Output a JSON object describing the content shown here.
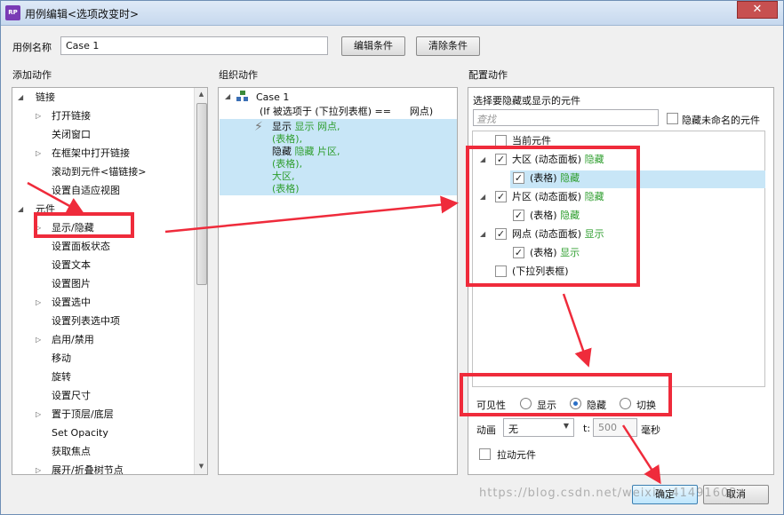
{
  "window": {
    "title": "用例编辑<选项改变时>",
    "app_icon": "RP",
    "close_symbol": "✕"
  },
  "case_name": {
    "label": "用例名称",
    "value": "Case 1"
  },
  "buttons": {
    "edit_condition": "编辑条件",
    "clear_condition": "清除条件",
    "ok": "确定",
    "cancel": "取消"
  },
  "add_action": {
    "header": "添加动作",
    "groups": [
      {
        "label": "链接",
        "items": [
          "打开链接",
          "关闭窗口",
          "在框架中打开链接",
          "滚动到元件<锚链接>",
          "设置自适应视图"
        ]
      },
      {
        "label": "元件",
        "items": [
          "显示/隐藏",
          "设置面板状态",
          "设置文本",
          "设置图片",
          "设置选中",
          "设置列表选中项",
          "启用/禁用",
          "移动",
          "旋转",
          "设置尺寸",
          "置于顶层/底层",
          "Set Opacity",
          "获取焦点",
          "展开/折叠树节点"
        ]
      }
    ]
  },
  "organize_action": {
    "header": "组织动作",
    "case_label": "Case 1",
    "condition": "(If 被选项于 (下拉列表框) ==      网点)",
    "action_lines": [
      "显示 网点,",
      "(表格),",
      "隐藏 片区,",
      "(表格),",
      "大区,",
      "(表格)"
    ]
  },
  "configure_action": {
    "header": "配置动作",
    "subheader": "选择要隐藏或显示的元件",
    "search_placeholder": "查找",
    "hide_unnamed_label": "隐藏未命名的元件",
    "tree": [
      {
        "label": "当前元件",
        "status": "",
        "checked": false
      },
      {
        "label": "大区 (动态面板)",
        "status": "隐藏",
        "checked": true
      },
      {
        "label": "(表格)",
        "status": "隐藏",
        "checked": true
      },
      {
        "label": "片区 (动态面板)",
        "status": "隐藏",
        "checked": true
      },
      {
        "label": "(表格)",
        "status": "隐藏",
        "checked": true
      },
      {
        "label": "网点 (动态面板)",
        "status": "显示",
        "checked": true
      },
      {
        "label": "(表格)",
        "status": "显示",
        "checked": true
      },
      {
        "label": "(下拉列表框)",
        "status": "",
        "checked": false
      }
    ],
    "visibility": {
      "label": "可见性",
      "options": [
        "显示",
        "隐藏",
        "切换"
      ],
      "selected": "隐藏"
    },
    "animation": {
      "label": "动画",
      "value": "无",
      "t_label": "t:",
      "duration": "500",
      "unit": "毫秒"
    },
    "drag_widget_label": "拉动元件"
  },
  "watermark": "https://blog.csdn.net/weixin_41491602",
  "colors": {
    "annotation_red": "#ef2b3b",
    "status_green": "#2f9e2f",
    "selection_blue": "#c8e6f7"
  },
  "icons": [
    "app-logo-icon",
    "close-icon",
    "expand-triangle-icon",
    "collapse-triangle-icon",
    "case-tree-icon",
    "lightning-icon",
    "checkbox-icon",
    "radio-icon",
    "dropdown-arrow-icon",
    "scroll-arrow-icon"
  ]
}
